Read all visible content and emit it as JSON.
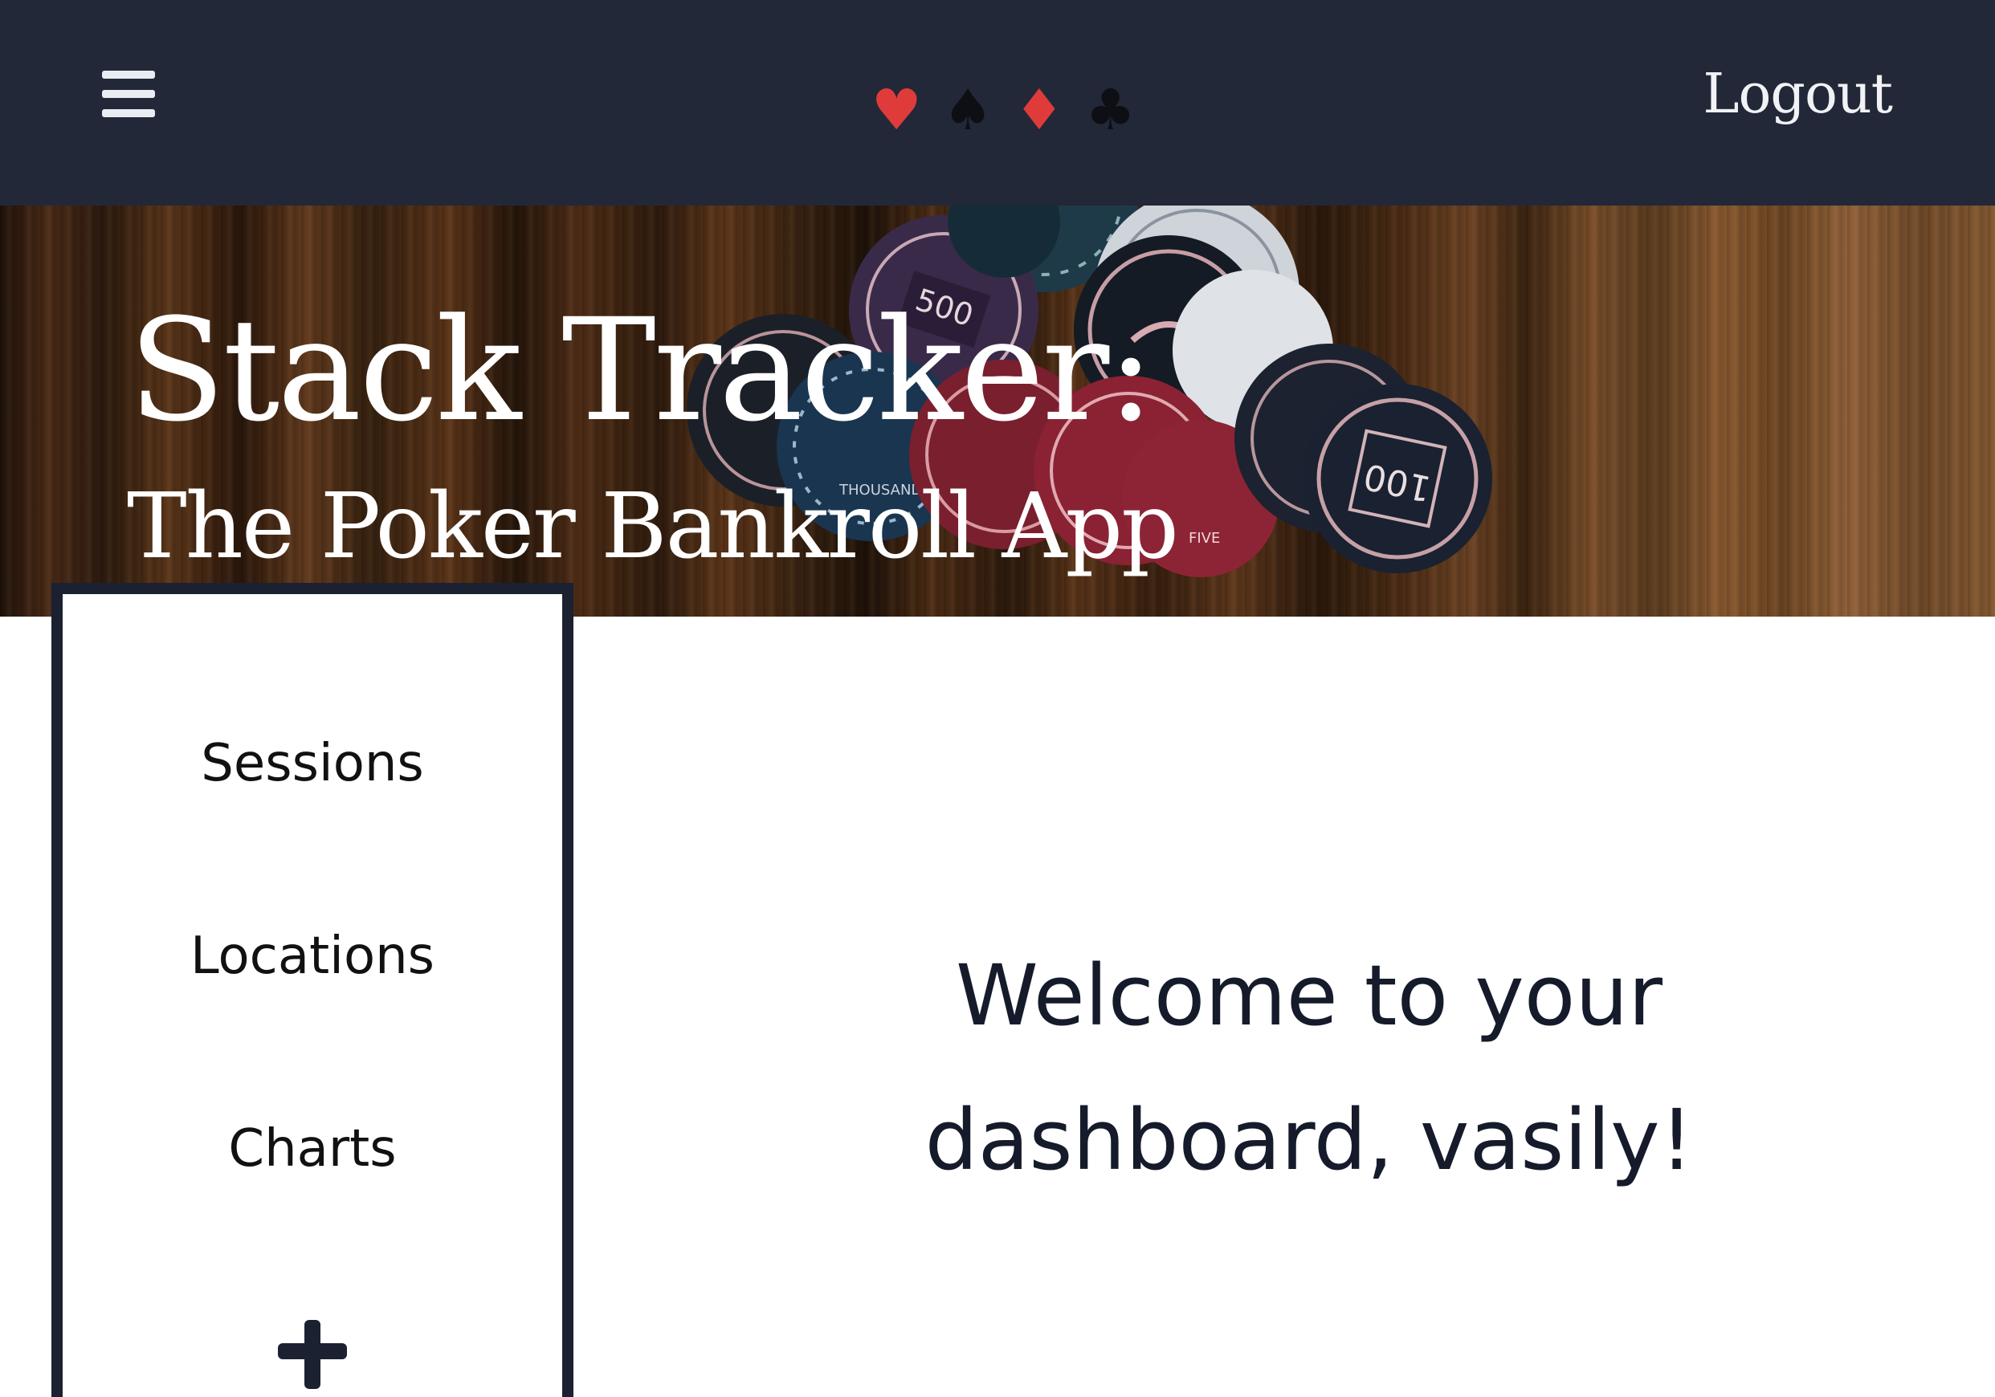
{
  "navbar": {
    "menu_icon": "hamburger-menu-icon",
    "suits": [
      {
        "glyph": "♥",
        "name": "heart",
        "color": "#e03b3b"
      },
      {
        "glyph": "♠",
        "name": "spade",
        "color": "#0d0f14"
      },
      {
        "glyph": "♦",
        "name": "diamond",
        "color": "#e03b3b"
      },
      {
        "glyph": "♣",
        "name": "club",
        "color": "#0d0f14"
      }
    ],
    "logout_label": "Logout"
  },
  "hero": {
    "title": "Stack Tracker:",
    "subtitle": "The Poker Bankroll App"
  },
  "sidebar": {
    "items": [
      {
        "label": "Sessions"
      },
      {
        "label": "Locations"
      },
      {
        "label": "Charts"
      }
    ],
    "add_icon": "plus-icon"
  },
  "main": {
    "welcome_line1": "Welcome to your",
    "welcome_line2": "dashboard, vasily!"
  },
  "colors": {
    "navbar_bg": "#222838",
    "sidebar_border": "#1b2130",
    "text_dark": "#161b2b",
    "suit_red": "#e03b3b"
  }
}
